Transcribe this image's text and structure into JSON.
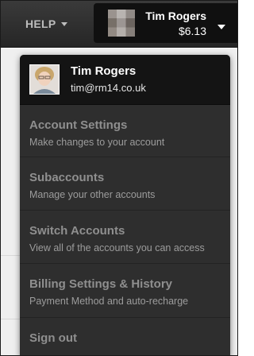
{
  "topbar": {
    "help_label": "HELP",
    "account": {
      "name": "Tim Rogers",
      "balance": "$6.13"
    }
  },
  "dropdown": {
    "user": {
      "name": "Tim Rogers",
      "email": "tim@rm14.co.uk"
    },
    "items": [
      {
        "title": "Account Settings",
        "subtitle": "Make changes to your account"
      },
      {
        "title": "Subaccounts",
        "subtitle": "Manage your other accounts"
      },
      {
        "title": "Switch Accounts",
        "subtitle": "View all of the accounts you can access"
      },
      {
        "title": "Billing Settings & History",
        "subtitle": "Payment Method and auto-recharge"
      },
      {
        "title": "Sign out",
        "subtitle": ""
      }
    ]
  },
  "icons": {
    "help_caret": "chevron-down-icon",
    "account_caret": "chevron-down-icon",
    "account_avatar": "avatar-icon",
    "header_avatar": "avatar-icon"
  },
  "colors": {
    "topbar": "#2f2f2f",
    "dropdown_bg": "#2e2e2e",
    "header_bg": "#141414",
    "menu_text": "#8f8f8f"
  }
}
